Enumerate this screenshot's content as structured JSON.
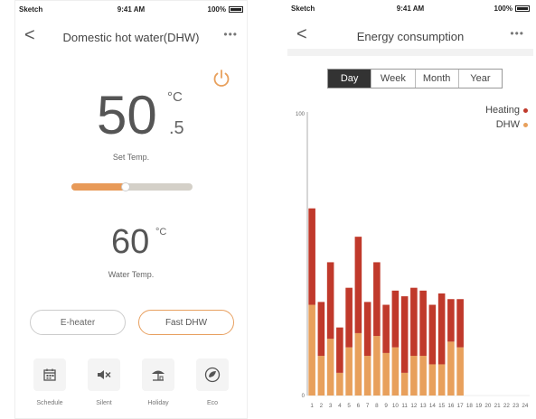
{
  "left": {
    "status": {
      "carrier": "Sketch",
      "time": "9:41 AM",
      "battery": "100%"
    },
    "nav": {
      "back": "<",
      "title": "Domestic hot water(DHW)",
      "more": "•••"
    },
    "set_temp": {
      "value": "50",
      "unit": "°C",
      "decimal": ".5",
      "label": "Set Temp."
    },
    "slider_level": 0.45,
    "water_temp": {
      "value": "60",
      "unit": "°C",
      "label": "Water Temp."
    },
    "buttons": {
      "eheater": "E-heater",
      "fastdhw": "Fast DHW"
    },
    "bottom": [
      {
        "label": "Schedule",
        "icon": "calendar-icon"
      },
      {
        "label": "Silent",
        "icon": "speaker-mute-icon"
      },
      {
        "label": "Holiday",
        "icon": "beach-umbrella-icon"
      },
      {
        "label": "Eco",
        "icon": "leaf-icon"
      }
    ],
    "colors": {
      "accent": "#e89a58"
    }
  },
  "right": {
    "status": {
      "carrier": "Sketch",
      "time": "9:41 AM",
      "battery": "100%"
    },
    "nav": {
      "back": "<",
      "title": "Energy consumption",
      "more": "•••"
    },
    "tabs": [
      "Day",
      "Week",
      "Month",
      "Year"
    ],
    "active_tab": 0
  },
  "chart_data": {
    "type": "bar",
    "stacked": true,
    "categories": [
      "1",
      "2",
      "3",
      "4",
      "5",
      "6",
      "7",
      "8",
      "9",
      "10",
      "11",
      "12",
      "13",
      "14",
      "15",
      "16",
      "17",
      "18",
      "19",
      "20",
      "21",
      "22",
      "23",
      "24"
    ],
    "y_tick_labels": [
      "0",
      "100"
    ],
    "ylim": [
      0,
      100
    ],
    "legend_position": "top-right",
    "series": [
      {
        "name": "DHW",
        "color": "#e8a05c",
        "values": [
          32,
          14,
          20,
          8,
          17,
          22,
          14,
          21,
          15,
          17,
          8,
          14,
          14,
          11,
          11,
          19,
          17,
          null,
          null,
          null,
          null,
          null,
          null,
          null
        ]
      },
      {
        "name": "Heating",
        "color": "#c0392b",
        "values": [
          34,
          19,
          27,
          16,
          21,
          34,
          19,
          26,
          17,
          20,
          27,
          24,
          23,
          21,
          25,
          15,
          17,
          null,
          null,
          null,
          null,
          null,
          null,
          null
        ]
      }
    ]
  }
}
